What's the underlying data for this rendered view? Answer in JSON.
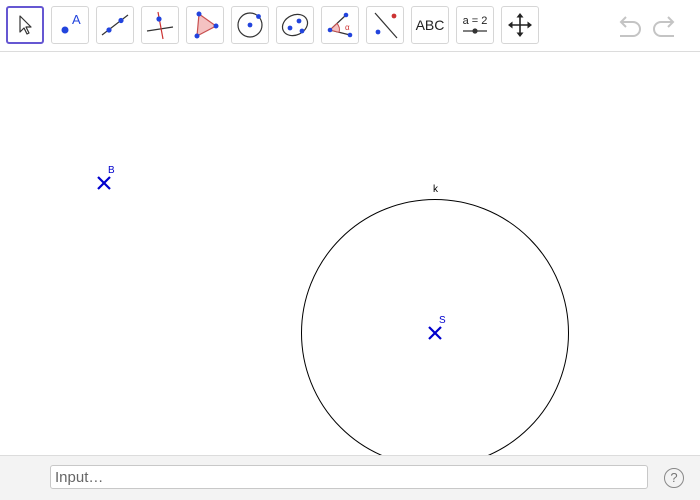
{
  "toolbar": {
    "tools": [
      {
        "name": "move-tool",
        "icon": "cursor-arrow-icon",
        "active": true
      },
      {
        "name": "point-tool",
        "icon": "point-icon",
        "label": "A"
      },
      {
        "name": "line-tool",
        "icon": "line-through-two-points-icon"
      },
      {
        "name": "perpendicular-line-tool",
        "icon": "perpendicular-line-icon"
      },
      {
        "name": "polygon-tool",
        "icon": "polygon-icon"
      },
      {
        "name": "circle-center-point-tool",
        "icon": "circle-with-center-icon"
      },
      {
        "name": "ellipse-tool",
        "icon": "ellipse-icon"
      },
      {
        "name": "angle-tool",
        "icon": "angle-icon",
        "label": "α"
      },
      {
        "name": "reflect-tool",
        "icon": "reflect-about-line-icon"
      },
      {
        "name": "text-tool",
        "icon": "text-icon",
        "label": "ABC"
      },
      {
        "name": "slider-tool",
        "icon": "slider-icon",
        "label": "a = 2"
      },
      {
        "name": "move-graphics-view-tool",
        "icon": "move-arrows-icon"
      }
    ],
    "undo": {
      "icon": "undo-icon"
    },
    "redo": {
      "icon": "redo-icon"
    }
  },
  "graphics": {
    "objects": {
      "point_b": {
        "label": "B"
      },
      "point_s": {
        "label": "S"
      },
      "circle_k": {
        "label": "k"
      }
    },
    "colors": {
      "point": "#0000cc",
      "circle": "#000000"
    }
  },
  "input_bar": {
    "placeholder": "Input…"
  },
  "help": {
    "label": "?"
  },
  "colors": {
    "accent": "#6557d2",
    "point": "#2244dd",
    "polygon_fill": "#f4c2c2",
    "polygon_stroke": "#c85050"
  }
}
